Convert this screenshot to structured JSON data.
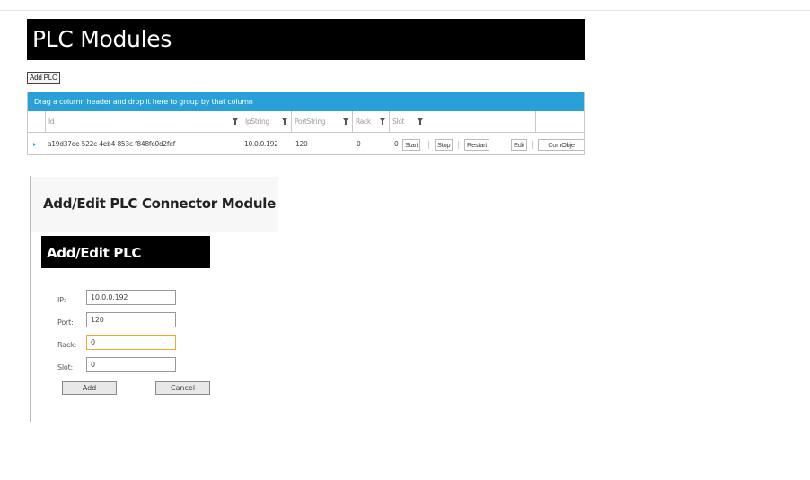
{
  "page": {
    "title": "PLC Modules"
  },
  "toolbar": {
    "add_plc_label": "Add PLC"
  },
  "grid": {
    "group_hint": "Drag a column header and drop it here to group by that column",
    "columns": [
      "Id",
      "IpString",
      "PortString",
      "Rack",
      "Slot"
    ],
    "rows": [
      {
        "id": "a19d37ee-522c-4eb4-853c-f848fe0d2fef",
        "ip": "10.0.0.192",
        "port": "120",
        "rack": "0",
        "slot": "0",
        "actions": [
          "Start",
          "Stop",
          "Restart",
          "Edit",
          "ComObje"
        ]
      }
    ]
  },
  "dialog": {
    "title": "Add/Edit PLC Connector Module",
    "form_title": "Add/Edit PLC",
    "fields": [
      {
        "label": "IP:",
        "value": "10.0.0.192"
      },
      {
        "label": "Port:",
        "value": "120"
      },
      {
        "label": "Rack:",
        "value": "0"
      },
      {
        "label": "Slot:",
        "value": "0"
      }
    ],
    "add_label": "Add",
    "cancel_label": "Cancel"
  },
  "colors": {
    "group_bar": "#2aa0d8",
    "banner": "#000000",
    "focus_border": "#f0a830"
  },
  "icons": {
    "filter": "filter-icon",
    "expand": "expand-row-icon"
  }
}
